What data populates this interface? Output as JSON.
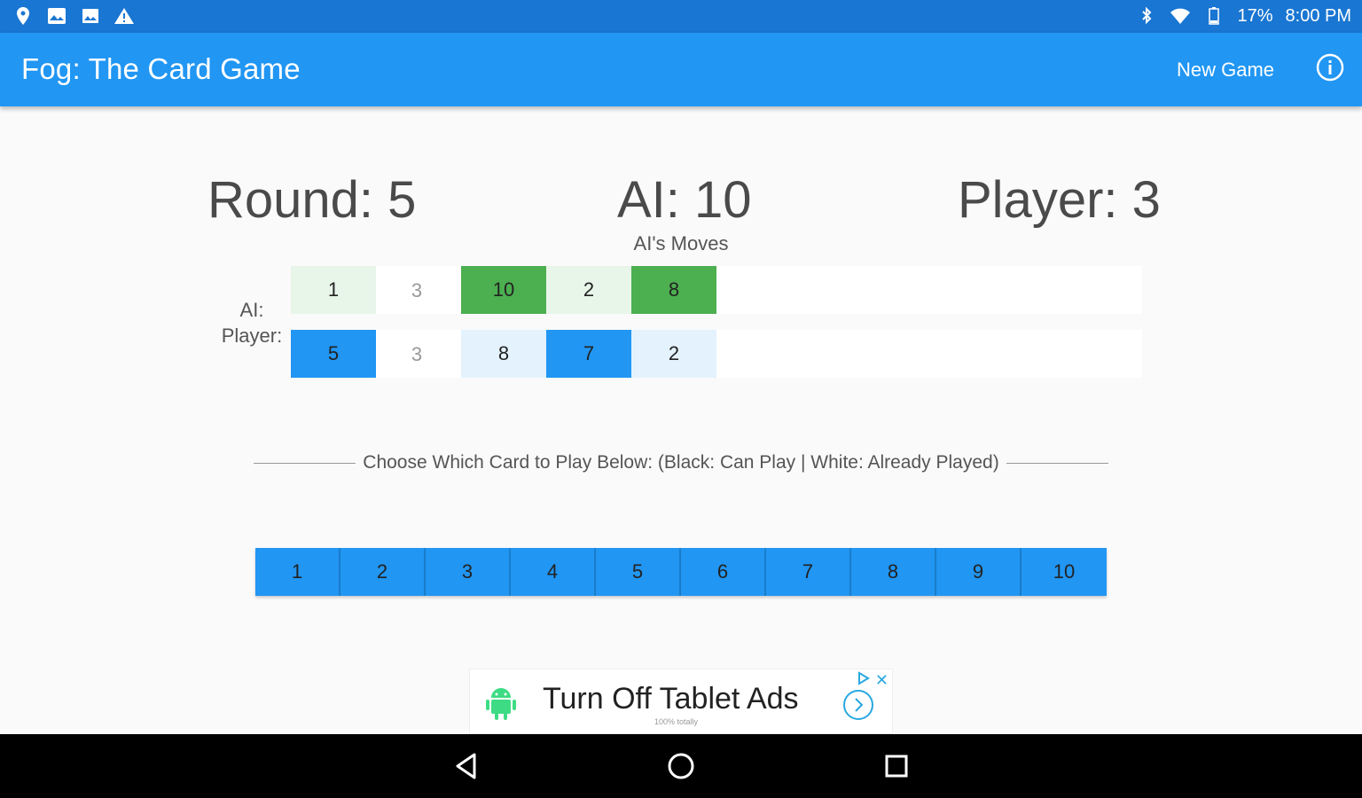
{
  "status_bar": {
    "battery": "17%",
    "time": "8:00 PM",
    "left_icons": [
      "location-icon",
      "gallery-icon",
      "image-icon",
      "warning-icon"
    ],
    "right_icons": [
      "bluetooth-icon",
      "wifi-icon",
      "battery-icon"
    ]
  },
  "app_bar": {
    "title": "Fog: The Card Game",
    "new_game_label": "New Game",
    "info_icon": "info-icon",
    "color": "#2196f3"
  },
  "scores": {
    "round": "Round: 5",
    "ai": "AI: 10",
    "player": "Player: 3"
  },
  "moves_label": "AI's Moves",
  "board": {
    "ai_label": "AI:",
    "player_label": "Player:",
    "ai_row": [
      {
        "value": "1",
        "style": "lightgreen"
      },
      {
        "value": "3",
        "style": "round"
      },
      {
        "value": "10",
        "style": "green"
      },
      {
        "value": "2",
        "style": "lightgreen"
      },
      {
        "value": "8",
        "style": "green"
      }
    ],
    "player_row": [
      {
        "value": "5",
        "style": "blue"
      },
      {
        "value": "3",
        "style": "round"
      },
      {
        "value": "8",
        "style": "lightblue"
      },
      {
        "value": "7",
        "style": "blue"
      },
      {
        "value": "2",
        "style": "lightblue"
      }
    ],
    "colors": {
      "win_green": "#4caf50",
      "lose_green": "#e8f5e9",
      "win_blue": "#2196f3",
      "lose_blue": "#e3f2fd"
    }
  },
  "instruction": "Choose Which Card to Play Below: (Black: Can Play | White: Already Played)",
  "hand": [
    "1",
    "2",
    "3",
    "4",
    "5",
    "6",
    "7",
    "8",
    "9",
    "10"
  ],
  "ad": {
    "headline": "Turn Off Tablet Ads",
    "fineprint": "100% totally",
    "close_icon": "close-icon",
    "adchoices_icon": "adchoices-icon",
    "arrow_icon": "chevron-right-icon",
    "logo_icon": "android-icon"
  },
  "nav_bar": {
    "buttons": [
      "back-icon",
      "home-icon",
      "recents-icon"
    ]
  }
}
